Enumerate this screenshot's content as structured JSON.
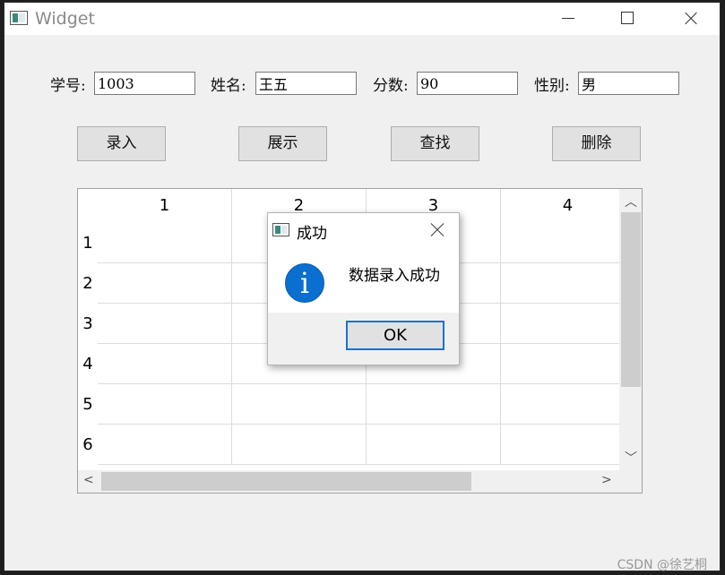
{
  "window": {
    "title": "Widget"
  },
  "form": {
    "id_label": "学号:",
    "id_value": "1003",
    "name_label": "姓名:",
    "name_value": "王五",
    "score_label": "分数:",
    "score_value": "90",
    "gender_label": "性别:",
    "gender_value": "男"
  },
  "buttons": {
    "add": "录入",
    "show": "展示",
    "find": "查找",
    "delete": "删除"
  },
  "table": {
    "columns": [
      "1",
      "2",
      "3",
      "4"
    ],
    "rows": [
      "1",
      "2",
      "3",
      "4",
      "5",
      "6"
    ]
  },
  "dialog": {
    "title": "成功",
    "message": "数据录入成功",
    "ok": "OK",
    "icon_glyph": "i"
  },
  "watermark": "CSDN @徐艺桐"
}
